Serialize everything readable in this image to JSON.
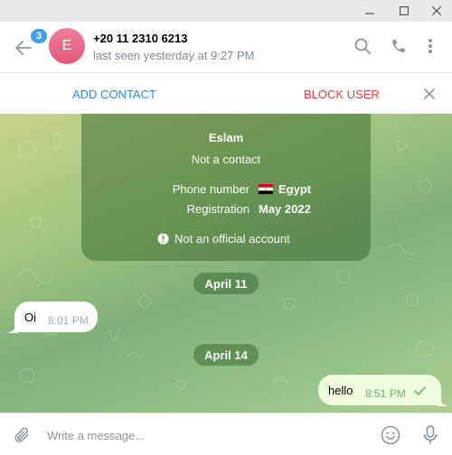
{
  "window": {
    "icons": {
      "minimize": "minimize-icon",
      "maximize": "maximize-icon",
      "close": "close-icon"
    }
  },
  "header": {
    "unread_count": "3",
    "avatar_initial": "E",
    "peer_phone": "+20 11 2310 6213",
    "peer_status": "last seen yesterday at 9:27 PM",
    "icons": {
      "back": "arrow-left-icon",
      "search": "search-icon",
      "call": "phone-icon",
      "menu": "more-vertical-icon"
    }
  },
  "action_bar": {
    "add_contact": "ADD CONTACT",
    "block_user": "BLOCK USER"
  },
  "info_card": {
    "name": "Eslam",
    "subtitle": "Not a contact",
    "phone_label": "Phone number",
    "phone_value": "Egypt",
    "registration_label": "Registration",
    "registration_value": "May 2022",
    "warning": "Not an official account"
  },
  "messages": [
    {
      "date": "April 11",
      "text": "Oi",
      "time": "8:01 PM",
      "direction": "incoming"
    },
    {
      "date": "April 14",
      "text": "hello",
      "time": "8:51 PM",
      "direction": "outgoing"
    }
  ],
  "composer": {
    "placeholder": "Write a message...",
    "icons": {
      "attach": "paperclip-icon",
      "emoji": "emoji-icon",
      "mic": "microphone-icon"
    }
  },
  "colors": {
    "accent": "#2d8bd0",
    "danger": "#d84040",
    "badge": "#43a0e4",
    "outgoing_bubble": "#effdde",
    "read_check": "#6fb56a"
  }
}
